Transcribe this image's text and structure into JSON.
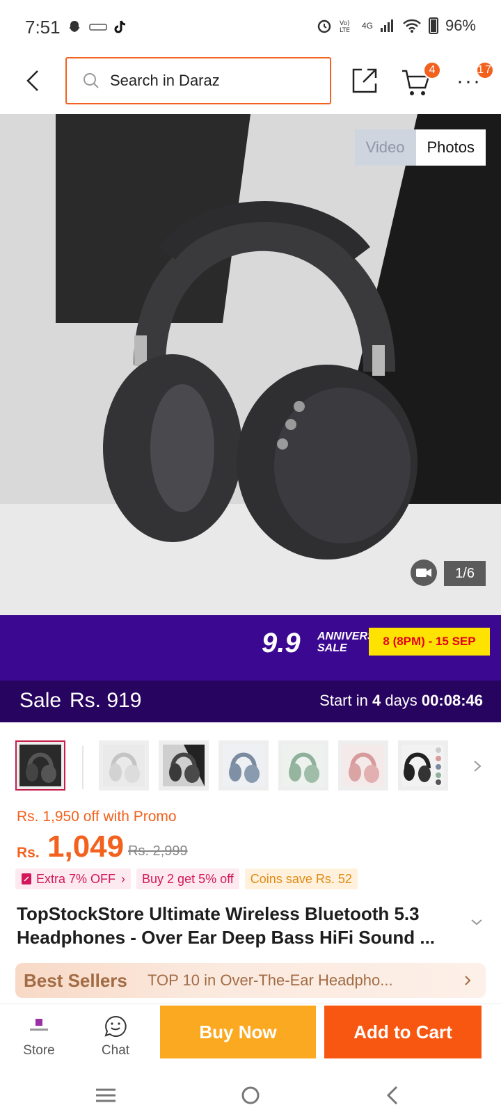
{
  "status_bar": {
    "time": "7:51",
    "network": "4G",
    "battery": "96%",
    "icons": [
      "snapchat-icon",
      "wemu-icon",
      "tiktok-icon",
      "alarm-icon",
      "volte-icon",
      "signal-icon",
      "wifi-icon",
      "battery-icon"
    ]
  },
  "top_bar": {
    "search_placeholder": "Search in Daraz",
    "cart_count": "4",
    "more_count": "17"
  },
  "gallery": {
    "toggle_video": "Video",
    "toggle_photos": "Photos",
    "counter": "1/6"
  },
  "campaign": {
    "logo_big": "9.9",
    "logo_small": "ANNIVERSARY SALE",
    "dates": "8 (8PM) - 15 SEP"
  },
  "sale_bar": {
    "label": "Sale",
    "price": "Rs. 919",
    "timer_prefix": "Start in ",
    "timer_days": "4",
    "timer_days_word": " days ",
    "timer_clock": "00:08:46"
  },
  "thumbnails": [
    "thumb-black",
    "thumb-silver",
    "thumb-black-2",
    "thumb-blue",
    "thumb-green",
    "thumb-pink",
    "thumb-colors"
  ],
  "price": {
    "promo": "Rs. 1,950 off with Promo",
    "currency": "Rs.",
    "current": "1,049",
    "original": "Rs. 2,999",
    "tag_extra": "Extra 7% OFF",
    "tag_buy2": "Buy 2 get 5% off",
    "tag_coins": "Coins save Rs. 52"
  },
  "product": {
    "title": "TopStockStore Ultimate Wireless Bluetooth 5.3 Headphones - Over Ear Deep Bass HiFi Sound ..."
  },
  "best_sellers": {
    "label": "Best Sellers",
    "text": "TOP 10 in Over-The-Ear Headpho..."
  },
  "bottom_bar": {
    "store_label": "Store",
    "chat_label": "Chat",
    "buy_now": "Buy Now",
    "add_to_cart": "Add to Cart"
  },
  "colors": {
    "brand_orange": "#f2611d",
    "campaign_purple": "#3b0891",
    "sale_purple": "#27045f",
    "buy_now_yellow": "#fca922",
    "add_cart_orange": "#f85711"
  }
}
